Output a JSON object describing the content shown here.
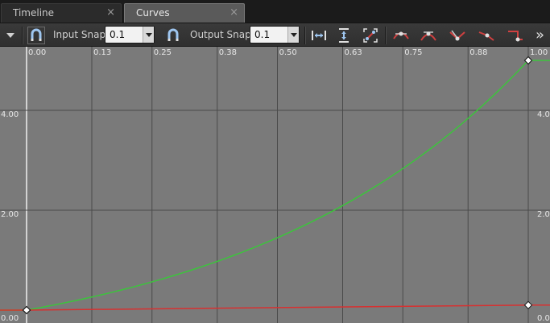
{
  "tabs": [
    {
      "label": "Timeline",
      "active": false
    },
    {
      "label": "Curves",
      "active": true
    }
  ],
  "tab_close_glyph": "×",
  "toolbar": {
    "input_snap_label": "Input Snap",
    "input_snap_value": "0.1",
    "output_snap_label": "Output Snap",
    "output_snap_value": "0.1",
    "overflow_glyph": "»",
    "icons": [
      "dropdown-arrow-icon",
      "snap-magnet-icon",
      "output-snap-magnet-icon",
      "fit-horizontal-icon",
      "fit-vertical-icon",
      "fit-selection-icon",
      "auto-tangent-icon",
      "user-tangent-icon",
      "break-tangent-icon",
      "linear-interp-icon",
      "constant-interp-icon"
    ]
  },
  "colors": {
    "graph_bg": "#7a7a7a",
    "grid": "#4a4a4a",
    "curve_green": "#3cc43c",
    "curve_red": "#d83030",
    "axis_white": "#f0f0f0"
  },
  "chart_data": {
    "type": "line",
    "x_ticks": [
      "0.00",
      "0.13",
      "0.25",
      "0.38",
      "0.50",
      "0.63",
      "0.75",
      "0.88",
      "1.00"
    ],
    "y_ticks": [
      "0.00",
      "2.00",
      "4.00"
    ],
    "xlim": [
      0,
      1.05
    ],
    "series": [
      {
        "color": "#3cc43c",
        "type": "exponential",
        "x": [
          0,
          0.125,
          0.25,
          0.375,
          0.5,
          0.625,
          0.75,
          0.875,
          1.0
        ],
        "y": [
          0,
          0.39,
          0.79,
          1.22,
          1.69,
          2.22,
          2.89,
          3.81,
          5.0
        ],
        "keys": [
          [
            0,
            0
          ],
          [
            1.0,
            5.0
          ]
        ]
      },
      {
        "color": "#d83030",
        "type": "linear",
        "x": [
          0,
          1.0
        ],
        "y": [
          0,
          0.1
        ],
        "keys": [
          [
            0,
            0
          ],
          [
            1.0,
            0.1
          ]
        ]
      }
    ]
  }
}
